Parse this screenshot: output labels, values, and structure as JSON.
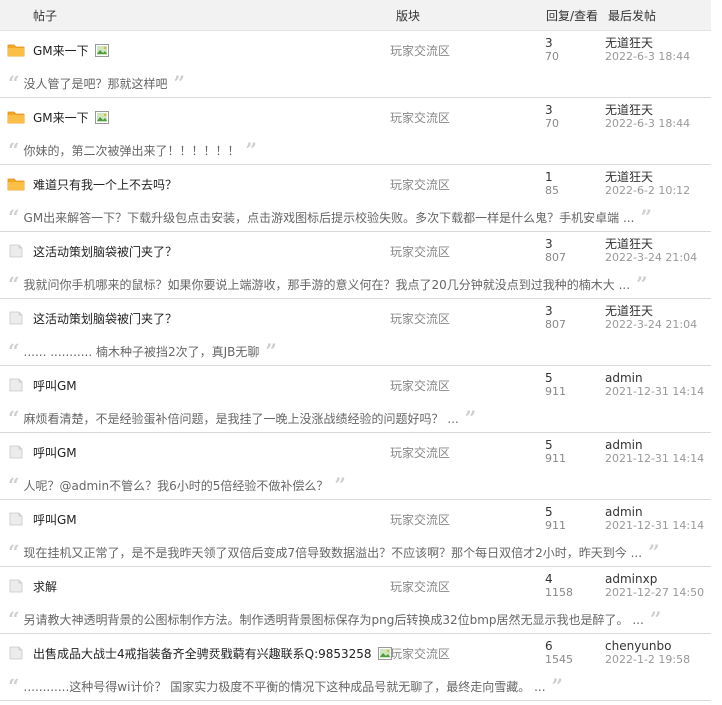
{
  "header": {
    "col_title": "帖子",
    "col_forum": "版块",
    "col_stats": "回复/查看",
    "col_last": "最后发帖"
  },
  "threads": [
    {
      "icon": "folder-icon",
      "title": "GM来一下",
      "has_image": true,
      "forum": "玩家交流区",
      "replies": "3",
      "views": "70",
      "last_user": "无道狂天",
      "last_time": "2022-6-3 18:44",
      "excerpt": "没人管了是吧？那就这样吧"
    },
    {
      "icon": "folder-icon",
      "title": "GM来一下",
      "has_image": true,
      "forum": "玩家交流区",
      "replies": "3",
      "views": "70",
      "last_user": "无道狂天",
      "last_time": "2022-6-3 18:44",
      "excerpt": "你妹的，第二次被弹出来了！！！！！！"
    },
    {
      "icon": "folder-icon",
      "title": "难道只有我一个上不去吗？",
      "has_image": false,
      "forum": "玩家交流区",
      "replies": "1",
      "views": "85",
      "last_user": "无道狂天",
      "last_time": "2022-6-2 10:12",
      "excerpt": "GM出来解答一下？下载升级包点击安装，点击游戏图标后提示校验失败。多次下载都一样是什么鬼？手机安卓端 ..."
    },
    {
      "icon": "page-icon",
      "title": "这活动策划脑袋被门夹了？",
      "has_image": false,
      "forum": "玩家交流区",
      "replies": "3",
      "views": "807",
      "last_user": "无道狂天",
      "last_time": "2022-3-24 21:04",
      "excerpt": "我就问你手机哪来的鼠标？如果你要说上端游收，那手游的意义何在？我点了20几分钟就没点到过我种的楠木大 ..."
    },
    {
      "icon": "page-icon",
      "title": "这活动策划脑袋被门夹了？",
      "has_image": false,
      "forum": "玩家交流区",
      "replies": "3",
      "views": "807",
      "last_user": "无道狂天",
      "last_time": "2022-3-24 21:04",
      "excerpt": "...... ........... 楠木种子被挡2次了，真JB无聊"
    },
    {
      "icon": "page-icon",
      "title": "呼叫GM",
      "has_image": false,
      "forum": "玩家交流区",
      "replies": "5",
      "views": "911",
      "last_user": "admin",
      "last_time": "2021-12-31 14:14",
      "excerpt": "麻烦看清楚，不是经验蛋补倍问题，是我挂了一晚上没涨战绩经验的问题好吗？ ..."
    },
    {
      "icon": "page-icon",
      "title": "呼叫GM",
      "has_image": false,
      "forum": "玩家交流区",
      "replies": "5",
      "views": "911",
      "last_user": "admin",
      "last_time": "2021-12-31 14:14",
      "excerpt": "人呢？@admin不管么？我6小时的5倍经验不做补偿么？"
    },
    {
      "icon": "page-icon",
      "title": "呼叫GM",
      "has_image": false,
      "forum": "玩家交流区",
      "replies": "5",
      "views": "911",
      "last_user": "admin",
      "last_time": "2021-12-31 14:14",
      "excerpt": "现在挂机又正常了，是不是我昨天领了双倍后变成7倍导致数据溢出？不应该啊？那个每日双倍才2小时，昨天到今 ..."
    },
    {
      "icon": "page-icon",
      "title": "求解",
      "has_image": false,
      "forum": "玩家交流区",
      "replies": "4",
      "views": "1158",
      "last_user": "adminxp",
      "last_time": "2021-12-27 14:50",
      "excerpt": "另请教大神透明背景的公图标制作方法。制作透明背景图标保存为png后转换成32位bmp居然无显示我也是醉了。 ..."
    },
    {
      "icon": "page-icon",
      "title": "出售成品大战士4戒指装备齐全骋烎戥藭有兴趣联系Q:9853258",
      "has_image": true,
      "forum": "玩家交流区",
      "replies": "6",
      "views": "1545",
      "last_user": "chenyunbo",
      "last_time": "2022-1-2 19:58",
      "excerpt": "............这种号得wi计价？ 国家实力极度不平衡的情况下这种成品号就无聊了，最终走向雪藏。 ..."
    }
  ],
  "colors": {
    "folder": "#f5a623",
    "page": "#e6e6e6",
    "header_bg": "#f2f2f2",
    "quote": "#cfcfcf"
  }
}
